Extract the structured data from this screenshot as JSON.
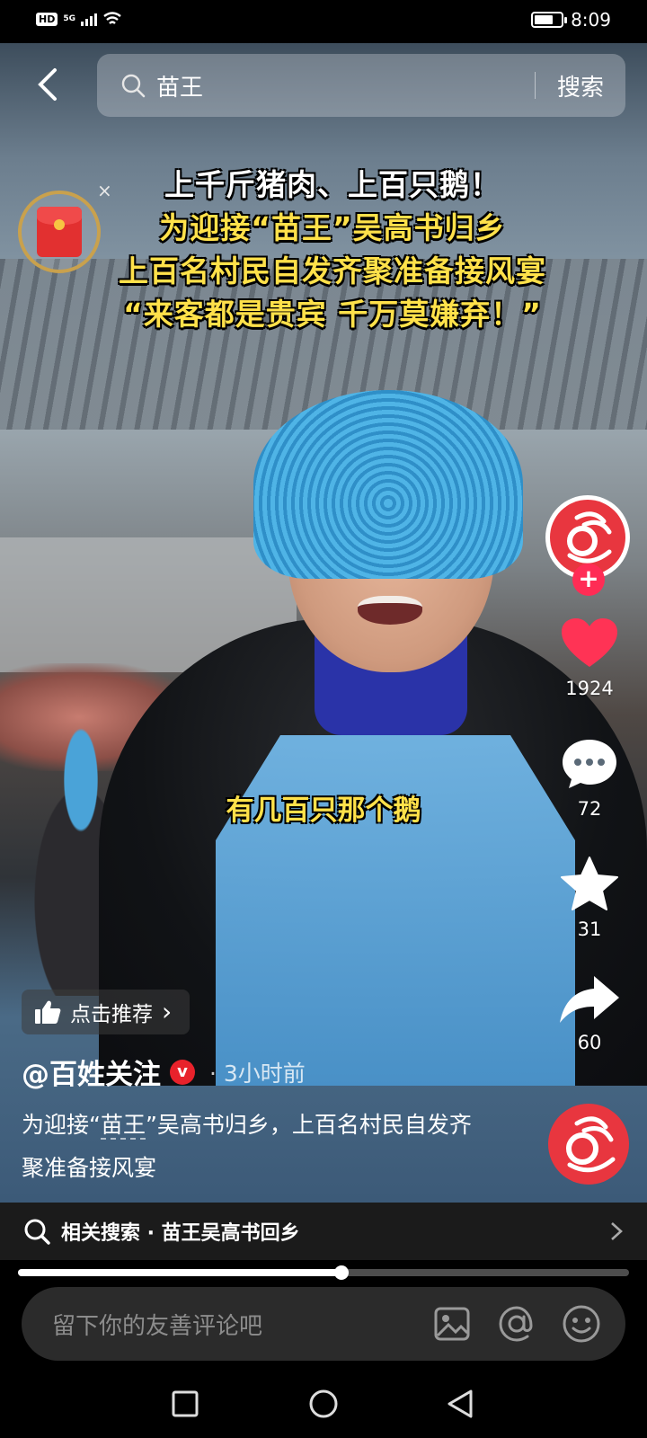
{
  "status_bar": {
    "hd": "HD",
    "network": "5G",
    "time": "8:09",
    "battery_level": 0.7
  },
  "search": {
    "query": "苗王",
    "button_label": "搜索"
  },
  "overlay": {
    "close_glyph": "×"
  },
  "headline": {
    "line1": "上千斤猪肉、上百只鹅！",
    "line2": "为迎接“苗王”吴高书归乡",
    "line3": "上百名村民自发齐聚准备接风宴",
    "line4": "“来客都是贵宾 千万莫嫌弃！”"
  },
  "subtitle": "有几百只那个鹅",
  "actions": {
    "likes": "1924",
    "comments": "72",
    "favorites": "31",
    "shares": "60",
    "follow_glyph": "+"
  },
  "recommend": {
    "label": "点击推荐",
    "arrow": "›"
  },
  "author": {
    "name": "@百姓关注",
    "verified_glyph": "v",
    "time": "· 3小时前"
  },
  "caption": {
    "part1": "为迎接“",
    "keyword": "苗王",
    "part2": "”吴高书归乡，上百名村民自发齐聚准备接风宴"
  },
  "related": {
    "label": "相关搜索 · 苗王吴高书回乡"
  },
  "progress": {
    "fraction": 0.53
  },
  "comment_bar": {
    "placeholder": "留下你的友善评论吧"
  },
  "colors": {
    "accent_red": "#e8363f",
    "headline_yellow": "#ffe14a",
    "like_red": "#ff3355"
  }
}
